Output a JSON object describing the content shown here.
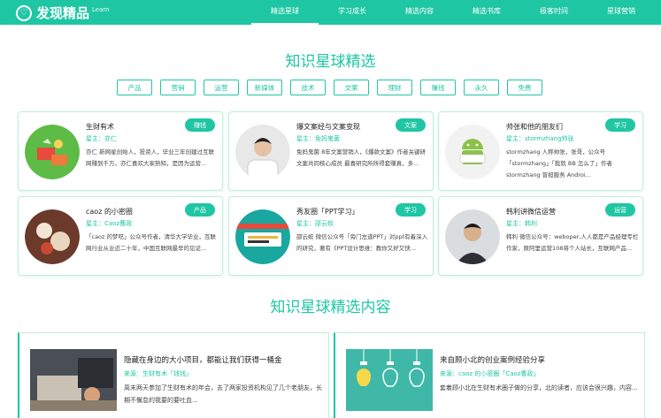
{
  "header": {
    "logo_text": "发现精品",
    "logo_sub": "Learn",
    "nav": [
      "精选星球",
      "学习成长",
      "精选内容",
      "精选书库",
      "极客时间",
      "星球营销"
    ]
  },
  "section1_title": "知识星球精选",
  "tags": [
    "产品",
    "营销",
    "运营",
    "新媒体",
    "技术",
    "文案",
    "理财",
    "赚钱",
    "永久",
    "免费"
  ],
  "cards": [
    {
      "title": "生财有术",
      "owner": "星主：亦仁",
      "desc": "亦仁 新网星创始人，投资人，毕业三年创建过互联网赚到千万，亦仁喜欢大家熟知，是因为运营...",
      "badge": "赚钱"
    },
    {
      "title": "爆文案经与文案变现",
      "owner": "星主：免妈鬼菌",
      "desc": "免妈鬼菌 8年文案营销人，《爆款文案》作者关键研文案共同核心成员 最喜研究所所得套赚真，多...",
      "badge": "文案"
    },
    {
      "title": "帅张和他的朋友们",
      "owner": "星主：stormzhang帅张",
      "desc": "stormzhang 人称帅张，张哥，公众号「stormzhang」「我就 BB 怎么了」作者 stormzhang 曾担服务 Androi...",
      "badge": "学习"
    },
    {
      "title": "caoz 的小密圈",
      "owner": "星主：Caoz曹政",
      "desc": "「caoz 的梦呓」公众号作者，清华大学毕业，互联网行业从业近二十年，中国互联网最早的见证...",
      "badge": "产品"
    },
    {
      "title": "秀友圈「PPT学习」",
      "owner": "星主：邵云蛟",
      "desc": "邵云蛟 微信公众号「旁门左道PPT」对ppt有着深入的研究，著有《PPT设计思维：教你又好又快...",
      "badge": "学习"
    },
    {
      "title": "韩利讲微信运营",
      "owner": "星主：韩利",
      "desc": "韩利 微信公众号：weboper,人人都是产品经理专栏作家，原阿里运营108将个人站长，互联网产品...",
      "badge": "运营"
    }
  ],
  "section2_title": "知识星球精选内容",
  "articles": [
    {
      "title": "隐藏在身边的大小项目，都能让我们获得一桶金",
      "source": "来源：生财有术「钱钱」",
      "desc": "周末两天参加了生财有术的年会，去了两家投资机构见了几个老朋友，长期不懈怠的我要的要吐血..."
    },
    {
      "title": "来自顾小北的创业案例经验分享",
      "source": "来源：caoz 的小密圈「Caoz曹政」",
      "desc": "套着顾小北在生财有术圈子做的分享，北的读者，应该会很兴趣，内容..."
    }
  ]
}
